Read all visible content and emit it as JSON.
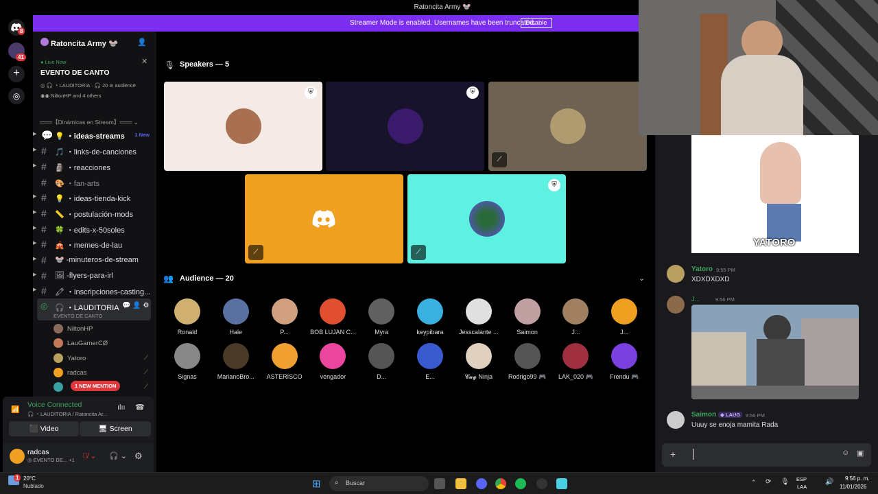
{
  "window_title": "Ratoncita Army 🐭",
  "banner": {
    "text": "Streamer Mode is enabled. Usernames have been truncated.",
    "button": "Disable"
  },
  "rail": {
    "badges": [
      "8",
      "41"
    ]
  },
  "server": {
    "name": "Ratoncita Army 🐭"
  },
  "live_card": {
    "status": "Live Now",
    "title": "EVENTO DE CANTO",
    "channel": "LAUDITORIA",
    "audience": "20 in audience",
    "participants": "NiltonHP and 4 others"
  },
  "category": "═══【Dinámicas en Stream】═══",
  "channels": [
    {
      "icon": "💡",
      "label": "・ideas-streams",
      "badge": "1 New"
    },
    {
      "icon": "🎵",
      "label": "・links-de-canciones"
    },
    {
      "icon": "🗿",
      "label": "・reacciones"
    },
    {
      "icon": "🎨",
      "label": "・fan-arts"
    },
    {
      "icon": "💡",
      "label": "・ideas-tienda-kick"
    },
    {
      "icon": "📏",
      "label": "・postulación-mods"
    },
    {
      "icon": "🍀",
      "label": "・edits-x-50soles"
    },
    {
      "icon": "🎪",
      "label": "・memes-de-lau"
    },
    {
      "icon": "🐭",
      "label": "-minuteros-de-stream"
    },
    {
      "icon": "🖼",
      "label": "-flyers-para-irl"
    },
    {
      "icon": "🖍",
      "label": "・inscripciones-casting..."
    }
  ],
  "stage_channel": {
    "name": "LAUDITORIA",
    "sub": "EVENTO DE CANTO"
  },
  "members": [
    "NiltonHP",
    "LauGamerCØ",
    "Yatoro",
    "radcas"
  ],
  "new_mention": "1 NEW MENTION",
  "voice": {
    "status": "Voice Connected",
    "location": "LAUDITORIA / Ratoncita Ar...",
    "video": "Video",
    "screen": "Screen"
  },
  "user": {
    "name": "radcas",
    "sub": "EVENTO DE...",
    "extra": "+1"
  },
  "speakers_header": "Speakers — 5",
  "audience_header": "Audience — 20",
  "audience": [
    "Ronald",
    "Hale",
    "P...",
    "BOB LUJAN C...",
    "Myra",
    "keypibara",
    "Jesscalante ...",
    "Saimon",
    "J...",
    "J...",
    "Signas",
    "MarianoBro...",
    "ASTERISCO",
    "vengador",
    "D...",
    "E...",
    "𝓒𝓾𝔂 Ninja",
    "Rodrigo99 🎮",
    "LAK_020 🎮",
    "Frendu 🎮"
  ],
  "chat": {
    "sticker_text": "YATORO",
    "messages": [
      {
        "author": "Yatoro",
        "time": "9:55 PM",
        "text": "XDXDXDXD",
        "color": "#3ba55d"
      },
      {
        "author": "J...",
        "time": "9:56 PM",
        "text": "",
        "color": "#3ba55d"
      },
      {
        "author": "Saimon",
        "tag": "LAUG",
        "time": "9:56 PM",
        "text": "Uuuy se enoja mamita Rada",
        "color": "#3ba55d"
      }
    ]
  },
  "taskbar": {
    "weather_temp": "20°C",
    "weather_desc": "Nublado",
    "search": "Buscar",
    "lang1": "ESP",
    "lang2": "LAA",
    "time": "9:56 p. m.",
    "date": "11/01/2026"
  },
  "colors": {
    "accent": "#7b2df0",
    "online": "#3ba55d",
    "mention": "#e0393d"
  }
}
